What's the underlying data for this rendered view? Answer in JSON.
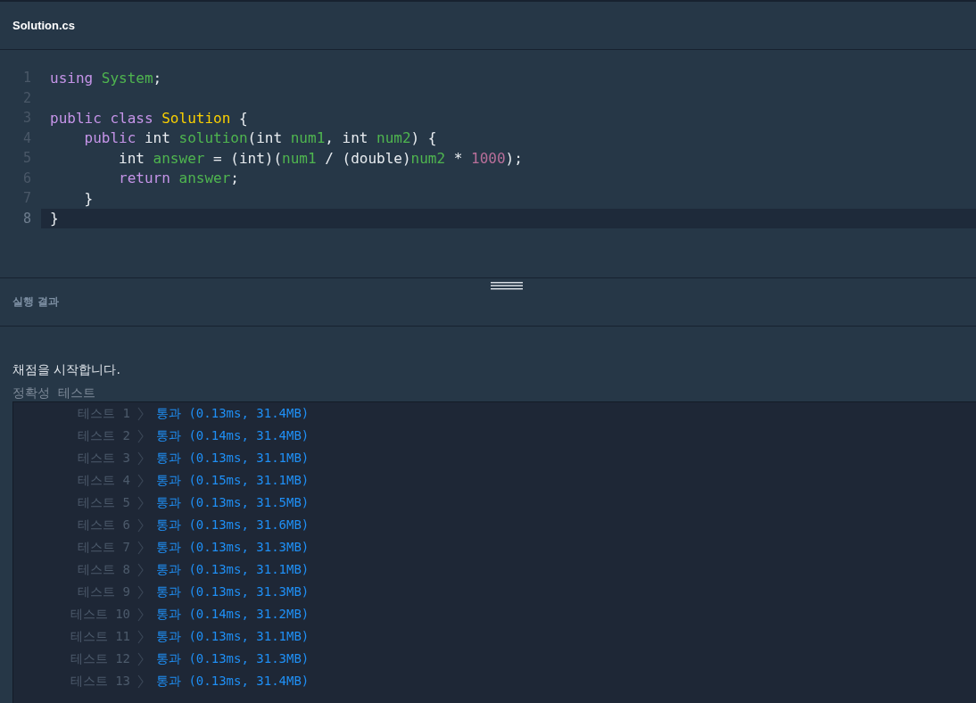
{
  "file_tab": {
    "title": "Solution.cs"
  },
  "code": {
    "lines": [
      {
        "number": "1",
        "current": false,
        "tokens": [
          {
            "kind": "keyword",
            "text": "using "
          },
          {
            "kind": "name",
            "text": "System"
          },
          {
            "kind": "plain",
            "text": ";"
          }
        ]
      },
      {
        "number": "2",
        "current": false
      },
      {
        "number": "3",
        "current": false,
        "tokens": [
          {
            "kind": "keyword",
            "text": "public class "
          },
          {
            "kind": "class",
            "text": "Solution"
          },
          {
            "kind": "plain",
            "text": " {"
          }
        ]
      },
      {
        "number": "4",
        "current": false,
        "tokens": [
          {
            "kind": "keyword",
            "text": "    public "
          },
          {
            "kind": "plain",
            "text": "int "
          },
          {
            "kind": "name",
            "text": "solution"
          },
          {
            "kind": "plain",
            "text": "(int "
          },
          {
            "kind": "name",
            "text": "num1"
          },
          {
            "kind": "plain",
            "text": ", int "
          },
          {
            "kind": "name",
            "text": "num2"
          },
          {
            "kind": "plain",
            "text": ") {"
          }
        ]
      },
      {
        "number": "5",
        "current": false,
        "tokens": [
          {
            "kind": "plain",
            "text": "        int "
          },
          {
            "kind": "name",
            "text": "answer"
          },
          {
            "kind": "plain",
            "text": " = (int)("
          },
          {
            "kind": "name",
            "text": "num1"
          },
          {
            "kind": "plain",
            "text": " / (double)"
          },
          {
            "kind": "name",
            "text": "num2"
          },
          {
            "kind": "plain",
            "text": " * "
          },
          {
            "kind": "number",
            "text": "1000"
          },
          {
            "kind": "plain",
            "text": ");"
          }
        ]
      },
      {
        "number": "6",
        "current": false,
        "tokens": [
          {
            "kind": "keyword",
            "text": "        return "
          },
          {
            "kind": "name",
            "text": "answer"
          },
          {
            "kind": "plain",
            "text": ";"
          }
        ]
      },
      {
        "number": "7",
        "current": false,
        "tokens": [
          {
            "kind": "plain",
            "text": "    }"
          }
        ]
      },
      {
        "number": "8",
        "current": true,
        "tokens": [
          {
            "kind": "plain",
            "text": "}"
          }
        ]
      }
    ]
  },
  "results_panel": {
    "title": "실행 결과",
    "message": "채점을 시작합니다.",
    "section": "정확성  테스트",
    "tests": [
      {
        "label": "테스트 1",
        "result": "통과 (0.13ms, 31.4MB)"
      },
      {
        "label": "테스트 2",
        "result": "통과 (0.14ms, 31.4MB)"
      },
      {
        "label": "테스트 3",
        "result": "통과 (0.13ms, 31.1MB)"
      },
      {
        "label": "테스트 4",
        "result": "통과 (0.15ms, 31.1MB)"
      },
      {
        "label": "테스트 5",
        "result": "통과 (0.13ms, 31.5MB)"
      },
      {
        "label": "테스트 6",
        "result": "통과 (0.13ms, 31.6MB)"
      },
      {
        "label": "테스트 7",
        "result": "통과 (0.13ms, 31.3MB)"
      },
      {
        "label": "테스트 8",
        "result": "통과 (0.13ms, 31.1MB)"
      },
      {
        "label": "테스트 9",
        "result": "통과 (0.13ms, 31.3MB)"
      },
      {
        "label": "테스트 10",
        "result": "통과 (0.14ms, 31.2MB)"
      },
      {
        "label": "테스트 11",
        "result": "통과 (0.13ms, 31.1MB)"
      },
      {
        "label": "테스트 12",
        "result": "통과 (0.13ms, 31.3MB)"
      },
      {
        "label": "테스트 13",
        "result": "통과 (0.13ms, 31.4MB)"
      }
    ]
  }
}
